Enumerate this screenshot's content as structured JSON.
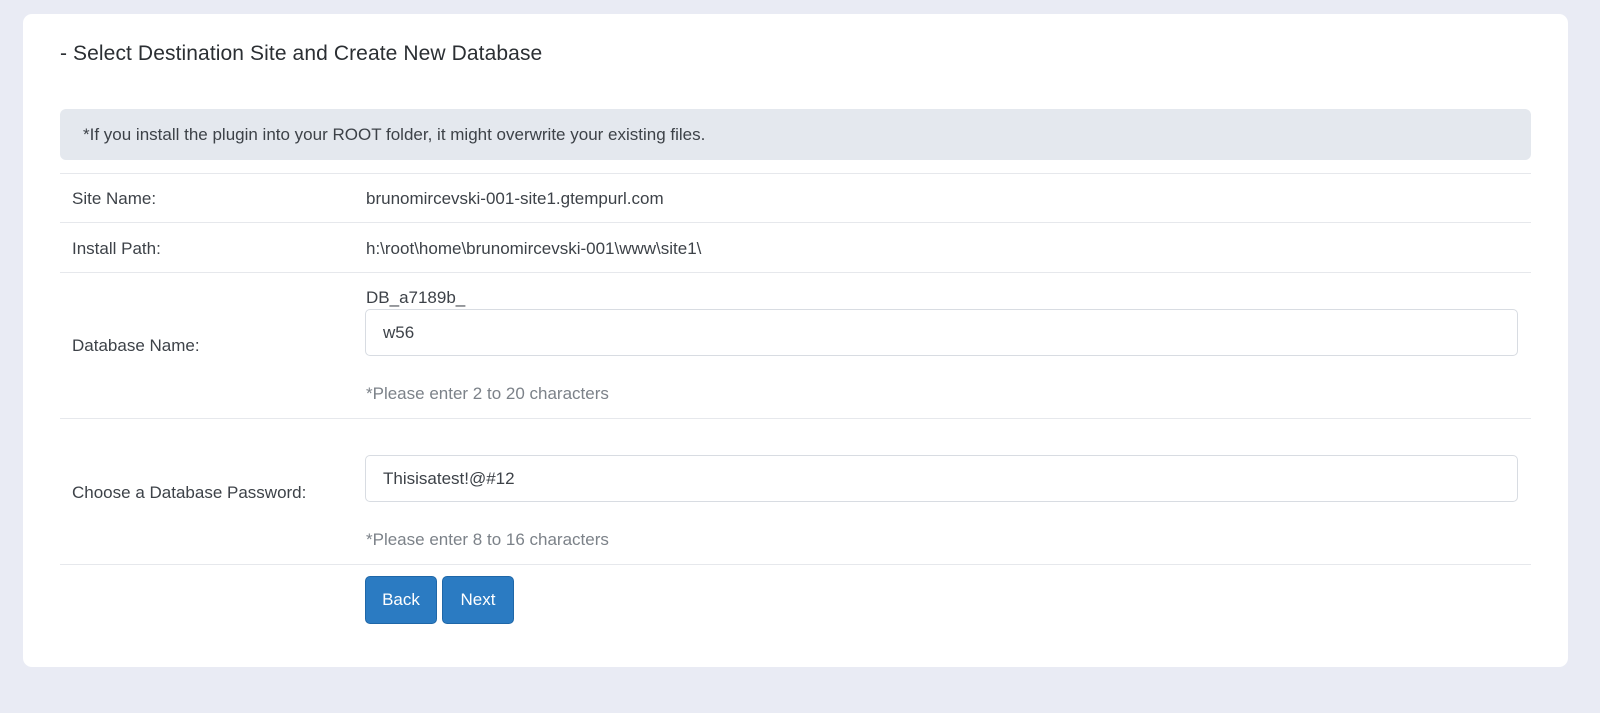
{
  "section": {
    "title": "- Select Destination Site and Create New Database",
    "notice": "*If you install the plugin into your ROOT folder, it might overwrite your existing files."
  },
  "form": {
    "site_name": {
      "label": "Site Name:",
      "value": "brunomircevski-001-site1.gtempurl.com"
    },
    "install_path": {
      "label": "Install Path:",
      "value": "h:\\root\\home\\brunomircevski-001\\www\\site1\\"
    },
    "database_name": {
      "label": "Database Name:",
      "prefix": "DB_a7189b_",
      "value": "w56",
      "hint": "*Please enter 2 to 20 characters"
    },
    "database_password": {
      "label": "Choose a Database Password:",
      "value": "Thisisatest!@#12",
      "hint": "*Please enter 8 to 16 characters"
    }
  },
  "buttons": {
    "back": "Back",
    "next": "Next"
  },
  "colors": {
    "background": "#e9ebf4",
    "card": "#ffffff",
    "notice_bg": "#e4e8ee",
    "button": "#2b7bc2",
    "hint_text": "#7c8289"
  }
}
